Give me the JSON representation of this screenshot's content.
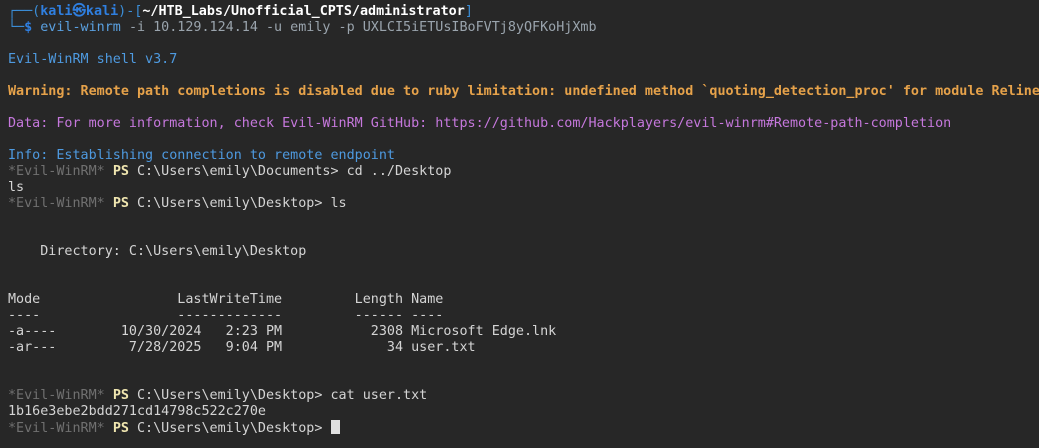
{
  "prompt": {
    "user": "kali",
    "at": "㉿",
    "host": "kali",
    "cwd": "~/HTB_Labs/Unofficial_CPTS/administrator",
    "command": "evil-winrm",
    "args": "-i 10.129.124.14 -u emily -p UXLCI5iETUsIBoFVTj8yQFKoHjXmb"
  },
  "output": {
    "banner": "Evil-WinRM shell v3.7",
    "warning": "Warning: Remote path completions is disabled due to ruby limitation: undefined method `quoting_detection_proc' for module Reline",
    "data": "Data: For more information, check Evil-WinRM GitHub: https://github.com/Hackplayers/evil-winrm#Remote-path-completion",
    "info": "Info: Establishing connection to remote endpoint"
  },
  "session": {
    "evil_tag": "*Evil-WinRM*",
    "ps": "PS",
    "lines": [
      {
        "path": "C:\\Users\\emily\\Documents>",
        "cmd": "cd ../Desktop"
      },
      {
        "path": "C:\\Users\\emily\\Desktop>",
        "cmd": "ls"
      },
      {
        "path": "C:\\Users\\emily\\Desktop>",
        "cmd": "cat user.txt"
      },
      {
        "path": "C:\\Users\\emily\\Desktop>",
        "cmd": ""
      }
    ],
    "stray_ls": "ls",
    "directory": "    Directory: C:\\Users\\emily\\Desktop",
    "table": {
      "header": "Mode                 LastWriteTime         Length Name",
      "underline": "----                 -------------         ------ ----",
      "rows": [
        "-a----        10/30/2024   2:23 PM           2308 Microsoft Edge.lnk",
        "-ar---         7/28/2025   9:04 PM             34 user.txt"
      ]
    },
    "flag": "1b16e3ebe2bdd271cd14798c522c270e"
  }
}
